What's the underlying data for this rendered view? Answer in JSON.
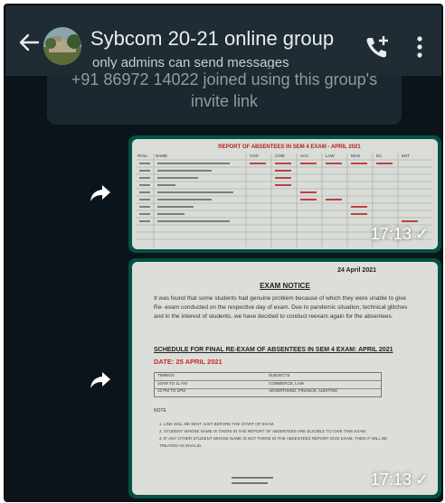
{
  "header": {
    "title": "Sybcom 20-21 online group",
    "subtitle": "only admins can send messages"
  },
  "system_message": {
    "line1": "+91 86972 14022 joined using this group's",
    "line2": "invite link"
  },
  "messages": [
    {
      "time": "17:13",
      "status": "✓",
      "image": {
        "title": "REPORT OF ABSENTEES IN SEM 4 EXAM - APRIL 2021",
        "col_headers": [
          "ROLL",
          "NAME",
          "COS",
          "COM",
          "ACC",
          "LAW",
          "MAN",
          "EC",
          "ENT"
        ]
      }
    },
    {
      "time": "17:13",
      "status": "✓",
      "image": {
        "date": "24 April 2021",
        "heading": "EXAM NOTICE",
        "body": "It was found that some students had genuine problem because of which they were unable to give Re- exam conducted on the respective day of exam. Due to pandemic situation, technical glitches and in the interest of students, we have decided to conduct reexam again for the absentees.",
        "schedule": "SCHEDULE FOR FINAL RE-EXAM OF ABSENTEES IN SEM 4 EXAM: APRIL 2021",
        "exam_date": "DATE: 25 APRIL 2021",
        "table": [
          [
            "TIMINGS",
            "SUBJECTS"
          ],
          [
            "10AM TO 11 AM",
            "COMMERCE, LAW"
          ],
          [
            "12 PM TO 1PM",
            "ADVERTISING, FINANCE, AUDITING"
          ]
        ],
        "note_label": "NOTE",
        "notes": [
          "1. LINK WILL BE SENT JUST BEFORE THE START OF EXAM.",
          "2. STUDENT WHOSE NAME IS THERE IN THE REPORT OF ABSENTEES ARE ELIGIBLE TO GIVE THIS EXAM.",
          "3. IF ANY OTHER STUDENT WHOSE NAME IS NOT THERE IN THE ABSENTEES REPORT GIVE EXAM, THEN IT WILL BE TREATED AS INVALID."
        ]
      }
    }
  ],
  "colors": {
    "header_bg": "#1f2c34",
    "chat_bg": "#0b141a",
    "bubble_bg": "#025144",
    "accent_red": "#c72c2c"
  },
  "icons": [
    "back-arrow-icon",
    "add-call-icon",
    "more-vert-icon",
    "forward-icon"
  ]
}
